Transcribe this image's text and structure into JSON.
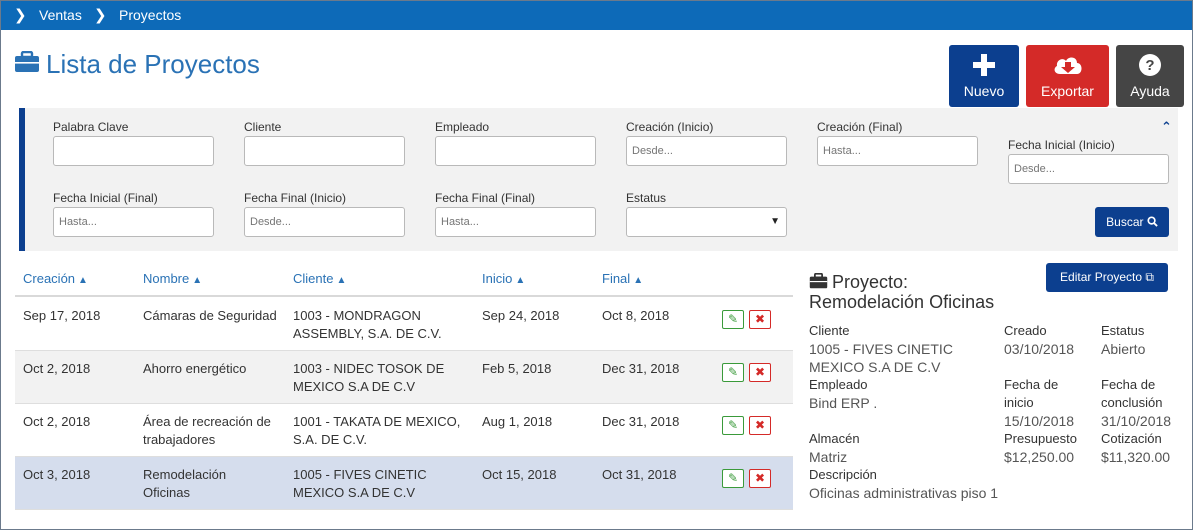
{
  "breadcrumb": [
    "Ventas",
    "Proyectos"
  ],
  "page": {
    "title": "Lista de Proyectos"
  },
  "actions": {
    "new": "Nuevo",
    "export": "Exportar",
    "help": "Ayuda"
  },
  "filters": {
    "keyword": {
      "label": "Palabra Clave",
      "placeholder": ""
    },
    "client": {
      "label": "Cliente",
      "placeholder": ""
    },
    "employee": {
      "label": "Empleado",
      "placeholder": ""
    },
    "created_start": {
      "label": "Creación (Inicio)",
      "placeholder": "Desde..."
    },
    "created_end": {
      "label": "Creación (Final)",
      "placeholder": "Hasta..."
    },
    "start_date_start": {
      "label": "Fecha Inicial (Inicio)",
      "placeholder": "Desde..."
    },
    "start_date_end": {
      "label": "Fecha Inicial (Final)",
      "placeholder": "Hasta..."
    },
    "end_date_start": {
      "label": "Fecha Final (Inicio)",
      "placeholder": "Desde..."
    },
    "end_date_end": {
      "label": "Fecha Final (Final)",
      "placeholder": "Hasta..."
    },
    "status": {
      "label": "Estatus",
      "value": ""
    },
    "search_button": "Buscar"
  },
  "table": {
    "headers": [
      "Creación",
      "Nombre",
      "Cliente",
      "Inicio",
      "Final"
    ],
    "rows": [
      {
        "created": "Sep 17, 2018",
        "name": [
          "Cámaras de Seguridad",
          ""
        ],
        "client": [
          "1003 - MONDRAGON",
          "ASSEMBLY, S.A. DE C.V."
        ],
        "start": "Sep 24, 2018",
        "end": "Oct 8, 2018"
      },
      {
        "created": "Oct 2, 2018",
        "name": [
          "Ahorro energético",
          ""
        ],
        "client": [
          "1003 - NIDEC TOSOK DE",
          "MEXICO S.A DE C.V"
        ],
        "start": "Feb 5, 2018",
        "end": "Dec 31, 2018"
      },
      {
        "created": "Oct 2, 2018",
        "name": [
          "Área de recreación de",
          "trabajadores"
        ],
        "client": [
          "1001 - TAKATA DE MEXICO,",
          "S.A. DE C.V."
        ],
        "start": "Aug 1, 2018",
        "end": "Dec 31, 2018"
      },
      {
        "created": "Oct 3, 2018",
        "name": [
          "Remodelación",
          "Oficinas"
        ],
        "client": [
          "1005 - FIVES CINETIC",
          "MEXICO S.A DE C.V"
        ],
        "start": "Oct 15, 2018",
        "end": "Oct 31, 2018"
      }
    ]
  },
  "detail": {
    "edit_button": "Editar Proyecto",
    "title_prefix": "Proyecto:",
    "title_name": "Remodelación Oficinas",
    "client_label": "Cliente",
    "client_value": [
      "1005 - FIVES CINETIC",
      "MEXICO S.A DE C.V"
    ],
    "created_label": "Creado",
    "created_value": "03/10/2018",
    "status_label": "Estatus",
    "status_value": "Abierto",
    "employee_label": "Empleado",
    "employee_value": "Bind ERP .",
    "start_label": [
      "Fecha de",
      "inicio"
    ],
    "start_value": "15/10/2018",
    "end_label": [
      "Fecha de",
      "conclusión"
    ],
    "end_value": "31/10/2018",
    "warehouse_label": "Almacén",
    "warehouse_value": "Matriz",
    "budget_label": "Presupuesto",
    "budget_value": "$12,250.00",
    "quote_label": "Cotización",
    "quote_value": "$11,320.00",
    "description_label": "Descripción",
    "description_value": "Oficinas administrativas piso 1"
  },
  "colors": {
    "primary": "#0c3f8f",
    "topbar": "#0d6ab8",
    "danger": "#d42a28",
    "dark": "#454545",
    "link": "#2a72b5",
    "selected_row": "#d5dded"
  },
  "icons": [
    "chevron-right-icon",
    "briefcase-icon",
    "plus-icon",
    "cloud-download-icon",
    "question-icon",
    "chevron-up-icon",
    "search-icon",
    "sort-icon",
    "edit-icon",
    "delete-icon",
    "external-edit-icon"
  ]
}
